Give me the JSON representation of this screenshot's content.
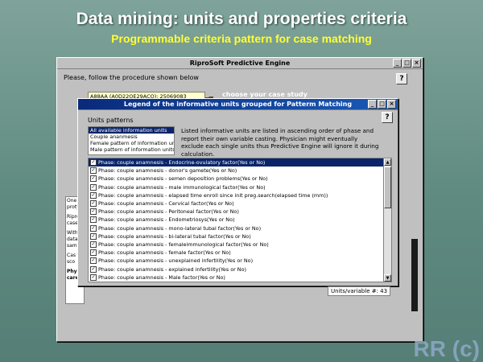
{
  "slide": {
    "title": "Data mining: units and properties criteria",
    "subtitle": "Programmable criteria pattern for case matching",
    "credit": "RR (c)"
  },
  "main_window": {
    "title": "RiproSoft Predictive Engine",
    "prompt": "Please, follow the procedure shown below",
    "help": "?",
    "case_field": "A88AA (A0D22OE29ACO): 25069083",
    "case_label": "choose your case study",
    "left_text": [
      "One",
      "proty",
      "Ripro",
      "case",
      "With",
      "data",
      "sam",
      "Cas",
      "sco",
      "Phy",
      "care"
    ],
    "buttons": {
      "minimize": "_",
      "maximize": "□",
      "close": "×"
    }
  },
  "legend_dialog": {
    "title": "Legend of the informative units grouped for Patterm Matching",
    "help": "?",
    "group_label": "Units patterns",
    "patterns": [
      "All available information units",
      "Couple ananmesis",
      "Female pattern of information units",
      "Male pattern of information units"
    ],
    "selected_pattern": 0,
    "description": "Listed informative units are listed in ascending order of phase and report their own variable casting. Physician might eventually exclude each single units thus Predictive Engine will ignore it during calculation.",
    "units": [
      "Phase: couple anamnesis - Endocrine-ovulatory factor(Yes or No)",
      "Phase: couple anamnesis - donor's gamete(Yes or No)",
      "Phase: couple anamnesis - semen deposition problems(Yes or No)",
      "Phase: couple anamnesis - male immunological factor(Yes or No)",
      "Phase: couple anamnesis - elapsed time enroll since init preg.search(elapsed time (mm))",
      "Phase: couple anamnesis - Cervical factor(Yes or No)",
      "Phase: couple anamnesis - Peritoneal factor(Yes or No)",
      "Phase: couple anamnesis - Endometriosys(Yes or No)",
      "Phase: couple anamnesis - mono-lateral tubal factor(Yes or No)",
      "Phase: couple anamnesis - bi-lateral tubal factor(Yes or No)",
      "Phase: couple anamnesis - femaleimmunological factor(Yes or No)",
      "Phase: couple anamnesis - female factor(Yes or No)",
      "Phase: couple anamnesis - unexplained infertility(Yes or No)",
      "Phase: couple anamnesis - explained infertility(Yes or No)",
      "Phase: couple anamnesis - Male factor(Yes or No)"
    ],
    "selected_unit": 0,
    "check_mark": "✓",
    "count_label": "Units/variable #: 43",
    "buttons": {
      "minimize": "_",
      "maximize": "□",
      "close": "×"
    }
  }
}
